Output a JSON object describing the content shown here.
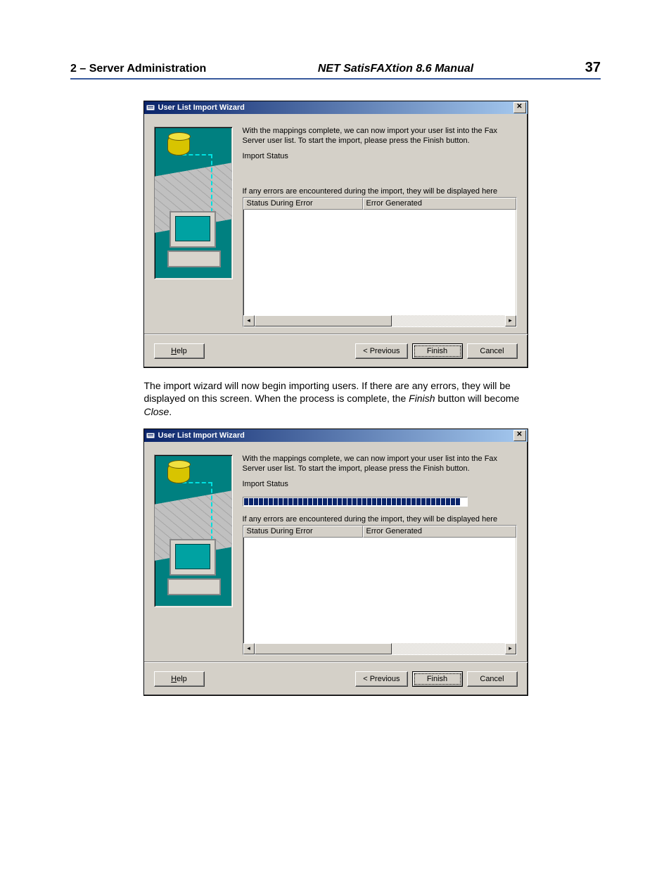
{
  "header": {
    "section": "2  – Server Administration",
    "title": "NET SatisFAXtion 8.6 Manual",
    "page": "37"
  },
  "dialog": {
    "title": "User List Import Wizard",
    "instruction": "With the mappings complete, we can now import your user list into the Fax Server user list.  To start the import, please press the Finish button.",
    "status_label": "Import Status",
    "error_label": "If any errors are encountered during the import, they will be displayed here",
    "col1": "Status During Error",
    "col2": "Error Generated",
    "help": "Help",
    "prev": "< Previous",
    "finish": "Finish",
    "cancel": "Cancel"
  },
  "paragraph": {
    "t1": "The import wizard will now begin importing users. If there are any errors, they will be displayed on this screen. When the process is complete, the ",
    "t2": "Finish",
    "t3": " button will become ",
    "t4": "Close",
    "t5": "."
  }
}
